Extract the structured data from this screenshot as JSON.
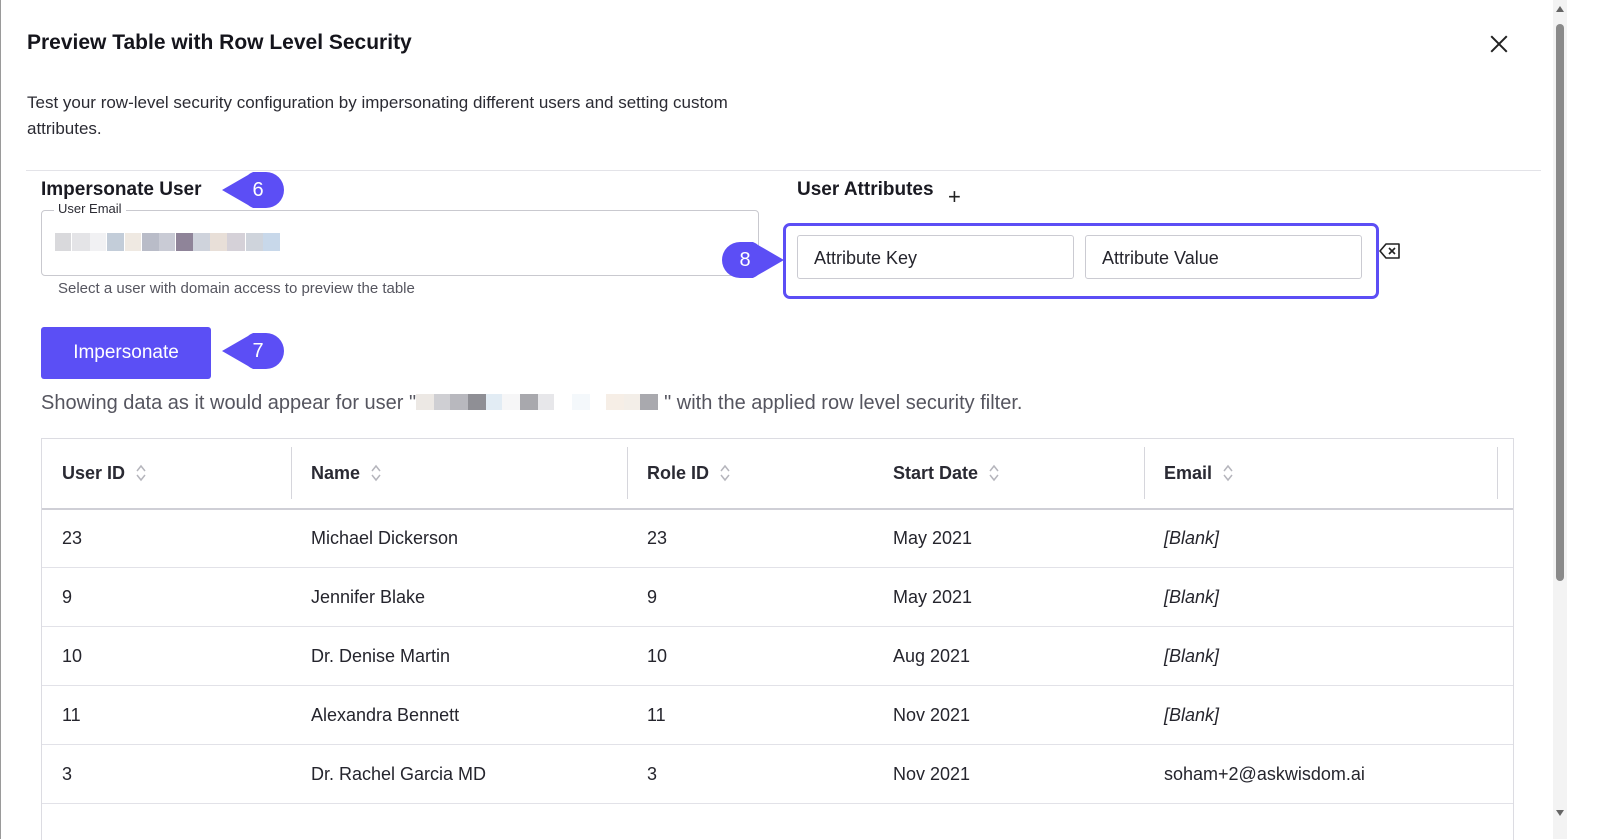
{
  "dialog": {
    "title": "Preview Table with Row Level Security",
    "description": "Test your row-level security configuration by impersonating different users and setting custom attributes."
  },
  "impersonate": {
    "title": "Impersonate User",
    "email_label": "User Email",
    "helper": "Select a user with domain access to preview the table",
    "button": "Impersonate"
  },
  "attributes": {
    "title": "User Attributes",
    "add": "+",
    "key_placeholder": "Attribute Key",
    "value_placeholder": "Attribute Value"
  },
  "badges": {
    "b6": "6",
    "b7": "7",
    "b8": "8"
  },
  "showing": {
    "prefix": "Showing data as it would appear for user \"",
    "suffix": "\" with the applied row level security filter."
  },
  "table": {
    "columns": [
      "User ID",
      "Name",
      "Role ID",
      "Start Date",
      "Email"
    ],
    "rows": [
      [
        "23",
        "Michael Dickerson",
        "23",
        "May 2021",
        "[Blank]"
      ],
      [
        "9",
        "Jennifer Blake",
        "9",
        "May 2021",
        "[Blank]"
      ],
      [
        "10",
        "Dr. Denise Martin",
        "10",
        "Aug 2021",
        "[Blank]"
      ],
      [
        "11",
        "Alexandra Bennett",
        "11",
        "Nov 2021",
        "[Blank]"
      ],
      [
        "3",
        "Dr. Rachel Garcia MD",
        "3",
        "Nov 2021",
        "soham+2@askwisdom.ai"
      ]
    ]
  },
  "colors": {
    "accent": "#5b4ff5",
    "badge": "#5c4ef5"
  }
}
